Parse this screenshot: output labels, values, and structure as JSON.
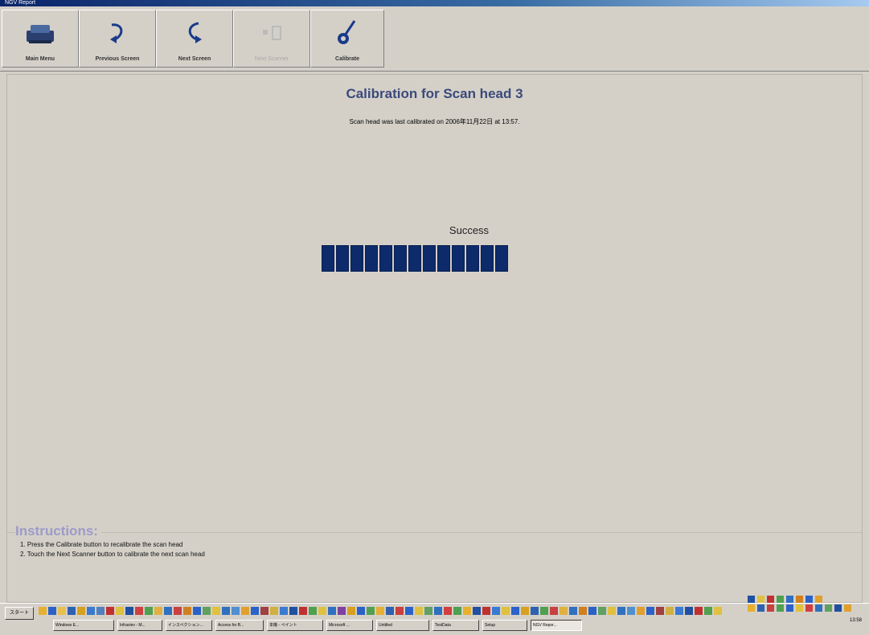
{
  "window": {
    "title": "NGV Report"
  },
  "toolbar": {
    "main_menu": "Main Menu",
    "previous_screen": "Previous Screen",
    "next_screen": "Next Screen",
    "next_scanner": "Next Scanner",
    "calibrate": "Calibrate"
  },
  "main": {
    "title": "Calibration for Scan head 3",
    "subtitle": "Scan head was last calibrated on 2006年11月22日 at 13:57.",
    "status": "Success",
    "progress_segments": 13,
    "progress_fraction": 1.0
  },
  "instructions": {
    "title": "Instructions:",
    "line1": "1. Press the Calibrate button to recalibrate the scan head",
    "line2": "2. Touch the Next Scanner button to calibrate the next scan head"
  },
  "taskbar": {
    "start": "スタート",
    "tasks": [
      "Windows E...",
      "Infraviev - M...",
      "インスペクション...",
      "Access for B...",
      "本機 - ペイント",
      "Microsoft ...",
      "Untitled",
      "TestData",
      "Setup",
      "NGV Repor..."
    ],
    "clock": "13:58"
  },
  "colors": {
    "accent": "#3b4a7a",
    "progress": "#0d2a6b",
    "instructions": "#9d9bc9",
    "background": "#d4d0c8"
  }
}
